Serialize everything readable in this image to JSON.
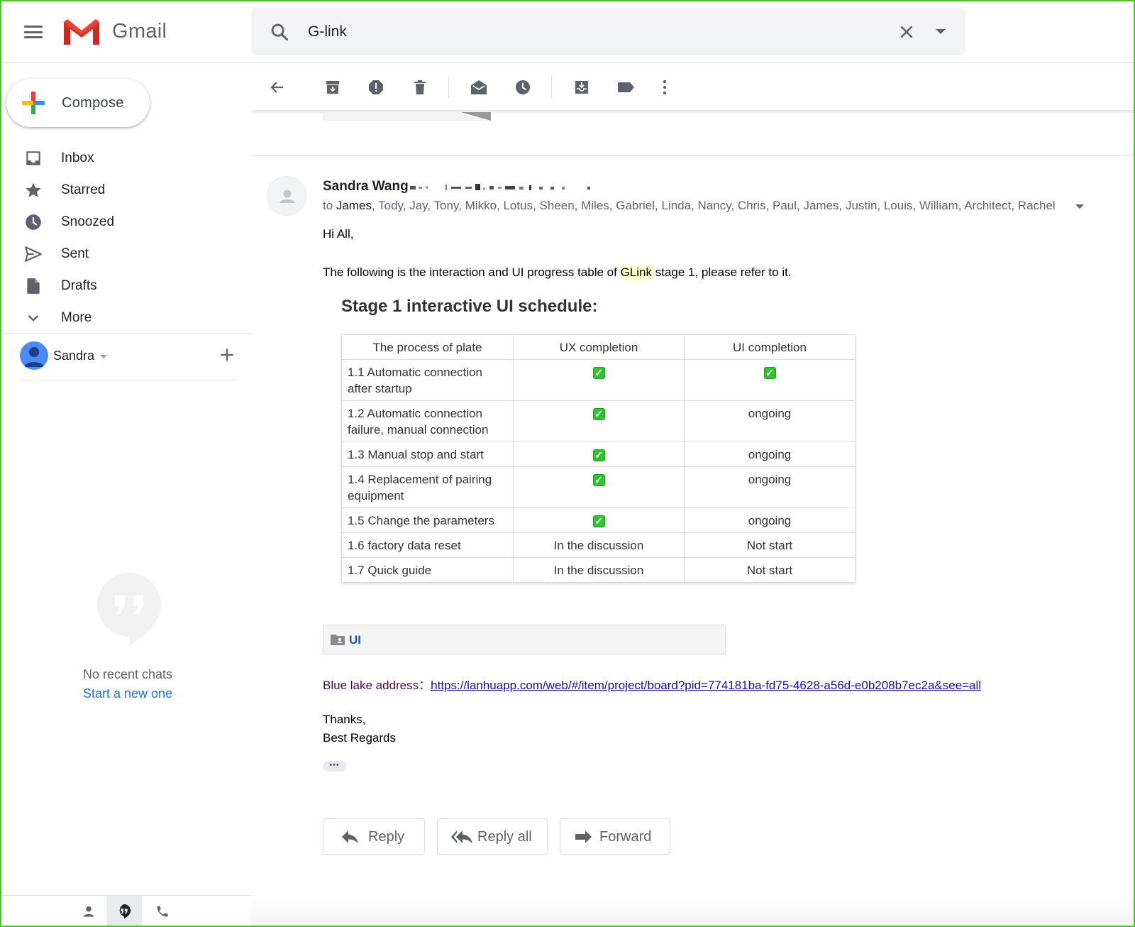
{
  "app": {
    "name": "Gmail",
    "accent_red": "#ea4335",
    "accent_blue": "#4285f4",
    "accent_yellow": "#fbbc04",
    "accent_green": "#34a853"
  },
  "search": {
    "value": "G-link",
    "icon": "search-icon",
    "clear_icon": "close-icon",
    "options_icon": "caret-down-icon"
  },
  "sidebar": {
    "compose_label": "Compose",
    "items": [
      {
        "label": "Inbox",
        "icon": "inbox-icon"
      },
      {
        "label": "Starred",
        "icon": "star-icon"
      },
      {
        "label": "Snoozed",
        "icon": "clock-icon"
      },
      {
        "label": "Sent",
        "icon": "send-icon"
      },
      {
        "label": "Drafts",
        "icon": "draft-icon"
      },
      {
        "label": "More",
        "icon": "chevron-down-icon"
      }
    ],
    "account_name": "Sandra",
    "no_chats": "No recent chats",
    "start_chat": "Start a new one"
  },
  "toolbar": {
    "icons": [
      "back-arrow-icon",
      "archive-icon",
      "report-spam-icon",
      "delete-icon",
      "mark-unread-icon",
      "snooze-icon",
      "move-to-inbox-icon",
      "label-icon",
      "more-vert-icon"
    ]
  },
  "message": {
    "sender_name": "Sandra Wang",
    "to_prefix": "to ",
    "to_first": "James",
    "to_rest": ", Tody, Jay, Tony, Mikko, Lotus, Sheen, Miles, Gabriel, Linda, Nancy, Chris, Paul, James, Justin, Louis, William, Architect, Rachel",
    "greeting": "Hi All,",
    "intro_before": "The following is the interaction and UI progress table of ",
    "intro_highlight": "GLink",
    "intro_after": " stage 1, please refer to it.",
    "schedule_title": "Stage 1 interactive UI schedule:",
    "table": {
      "headers": [
        "The process of plate",
        "UX completion",
        "UI completion"
      ],
      "rows": [
        {
          "process": "1.1 Automatic connection after startup",
          "ux": "✓",
          "ui": "✓"
        },
        {
          "process": "1.2 Automatic connection failure, manual connection",
          "ux": "✓",
          "ui": "ongoing"
        },
        {
          "process": "1.3 Manual stop and start",
          "ux": "✓",
          "ui": "ongoing"
        },
        {
          "process": "1.4 Replacement of pairing equipment",
          "ux": "✓",
          "ui": "ongoing"
        },
        {
          "process": "1.5 Change the parameters",
          "ux": "✓",
          "ui": "ongoing"
        },
        {
          "process": "1.6 factory data reset",
          "ux": "In the discussion",
          "ui": "Not start"
        },
        {
          "process": "1.7 Quick guide",
          "ux": "In the discussion",
          "ui": "Not start"
        }
      ]
    },
    "attachment_label": "UI",
    "blue_lake_label": "Blue lake address：",
    "blue_lake_url": "https://lanhuapp.com/web/#/item/project/board?pid=774181ba-fd75-4628-a56d-e0b208b7ec2a&see=all",
    "closing_1": "Thanks,",
    "closing_2": "Best Regards",
    "ellipsis": "•••"
  },
  "actions": {
    "reply": "Reply",
    "reply_all": "Reply all",
    "forward": "Forward"
  }
}
